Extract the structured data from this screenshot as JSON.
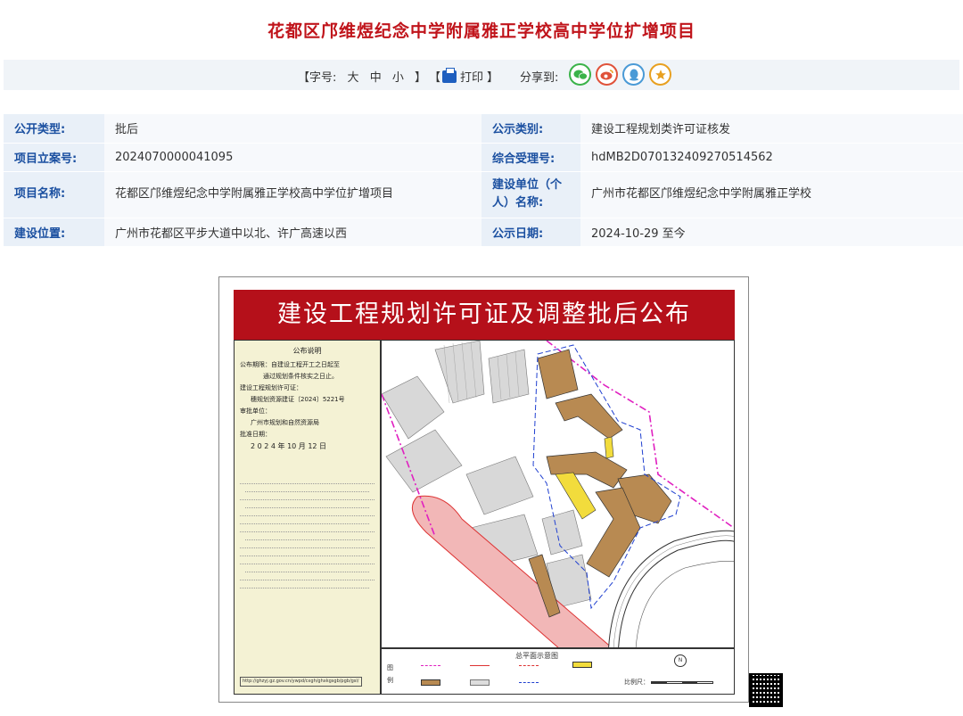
{
  "page": {
    "title": "花都区邝维煜纪念中学附属雅正学校高中学位扩增项目"
  },
  "toolbar": {
    "font_size_label": "【字号:",
    "size_large": "大",
    "size_medium": "中",
    "size_small": "小",
    "font_close": "】",
    "print_open": "【",
    "print_label": "打印",
    "print_close": "】",
    "share_label": "分享到:",
    "share_icons": [
      "wechat-icon",
      "weibo-icon",
      "qq-icon",
      "favorite-icon"
    ]
  },
  "info": {
    "gongkai_leixing_label": "公开类型:",
    "gongkai_leixing_value": "批后",
    "gongshi_leibie_label": "公示类别:",
    "gongshi_leibie_value": "建设工程规划类许可证核发",
    "lian_hao_label": "项目立案号:",
    "lian_hao_value": "2024070000041095",
    "shouli_hao_label": "综合受理号:",
    "shouli_hao_value": "hdMB2D070132409270514562",
    "xiangmu_mingcheng_label": "项目名称:",
    "xiangmu_mingcheng_value": "花都区邝维煜纪念中学附属雅正学校高中学位扩增项目",
    "jianshe_danwei_label": "建设单位（个人）名称:",
    "jianshe_danwei_value": "广州市花都区邝维煜纪念中学附属雅正学校",
    "jianshe_weizhi_label": "建设位置:",
    "jianshe_weizhi_value": "广州市花都区平步大道中以北、许广高速以西",
    "gongshi_riqi_label": "公示日期:",
    "gongshi_riqi_value": "2024-10-29 至今"
  },
  "poster": {
    "banner": "建设工程规划许可证及调整批后公布",
    "notice_title": "公布说明",
    "period_line1": "公布期限：自建设工程开工之日起至",
    "period_line2": "通过规划条件核实之日止。",
    "license_label": "建设工程规划许可证：",
    "license_no": "穗规划资源建证〔2024〕5221号",
    "approver_label": "审批单位：",
    "approver": "广州市规划和自然资源局",
    "date_label": "批准日期：",
    "date": "2 0 2 4 年 10 月 12 日",
    "plan_title": "总平面示意图",
    "scale_label": "比例尺：",
    "legend_label": "图例",
    "compass": "N",
    "url": "http://ghzyj.gz.gov.cn/ywpd/cxgh/ghxkgsgb/pgb/gsl/"
  },
  "colors": {
    "title_red": "#c0141b",
    "label_blue": "#1a4fa0",
    "label_bg": "#e9f0f8",
    "value_bg": "#f7f9fc",
    "banner_red": "#b5101a",
    "building_brown": "#b88a52",
    "yellow_block": "#f2dc3c",
    "boundary_magenta": "#e020c0",
    "boundary_blue": "#2040d0"
  }
}
